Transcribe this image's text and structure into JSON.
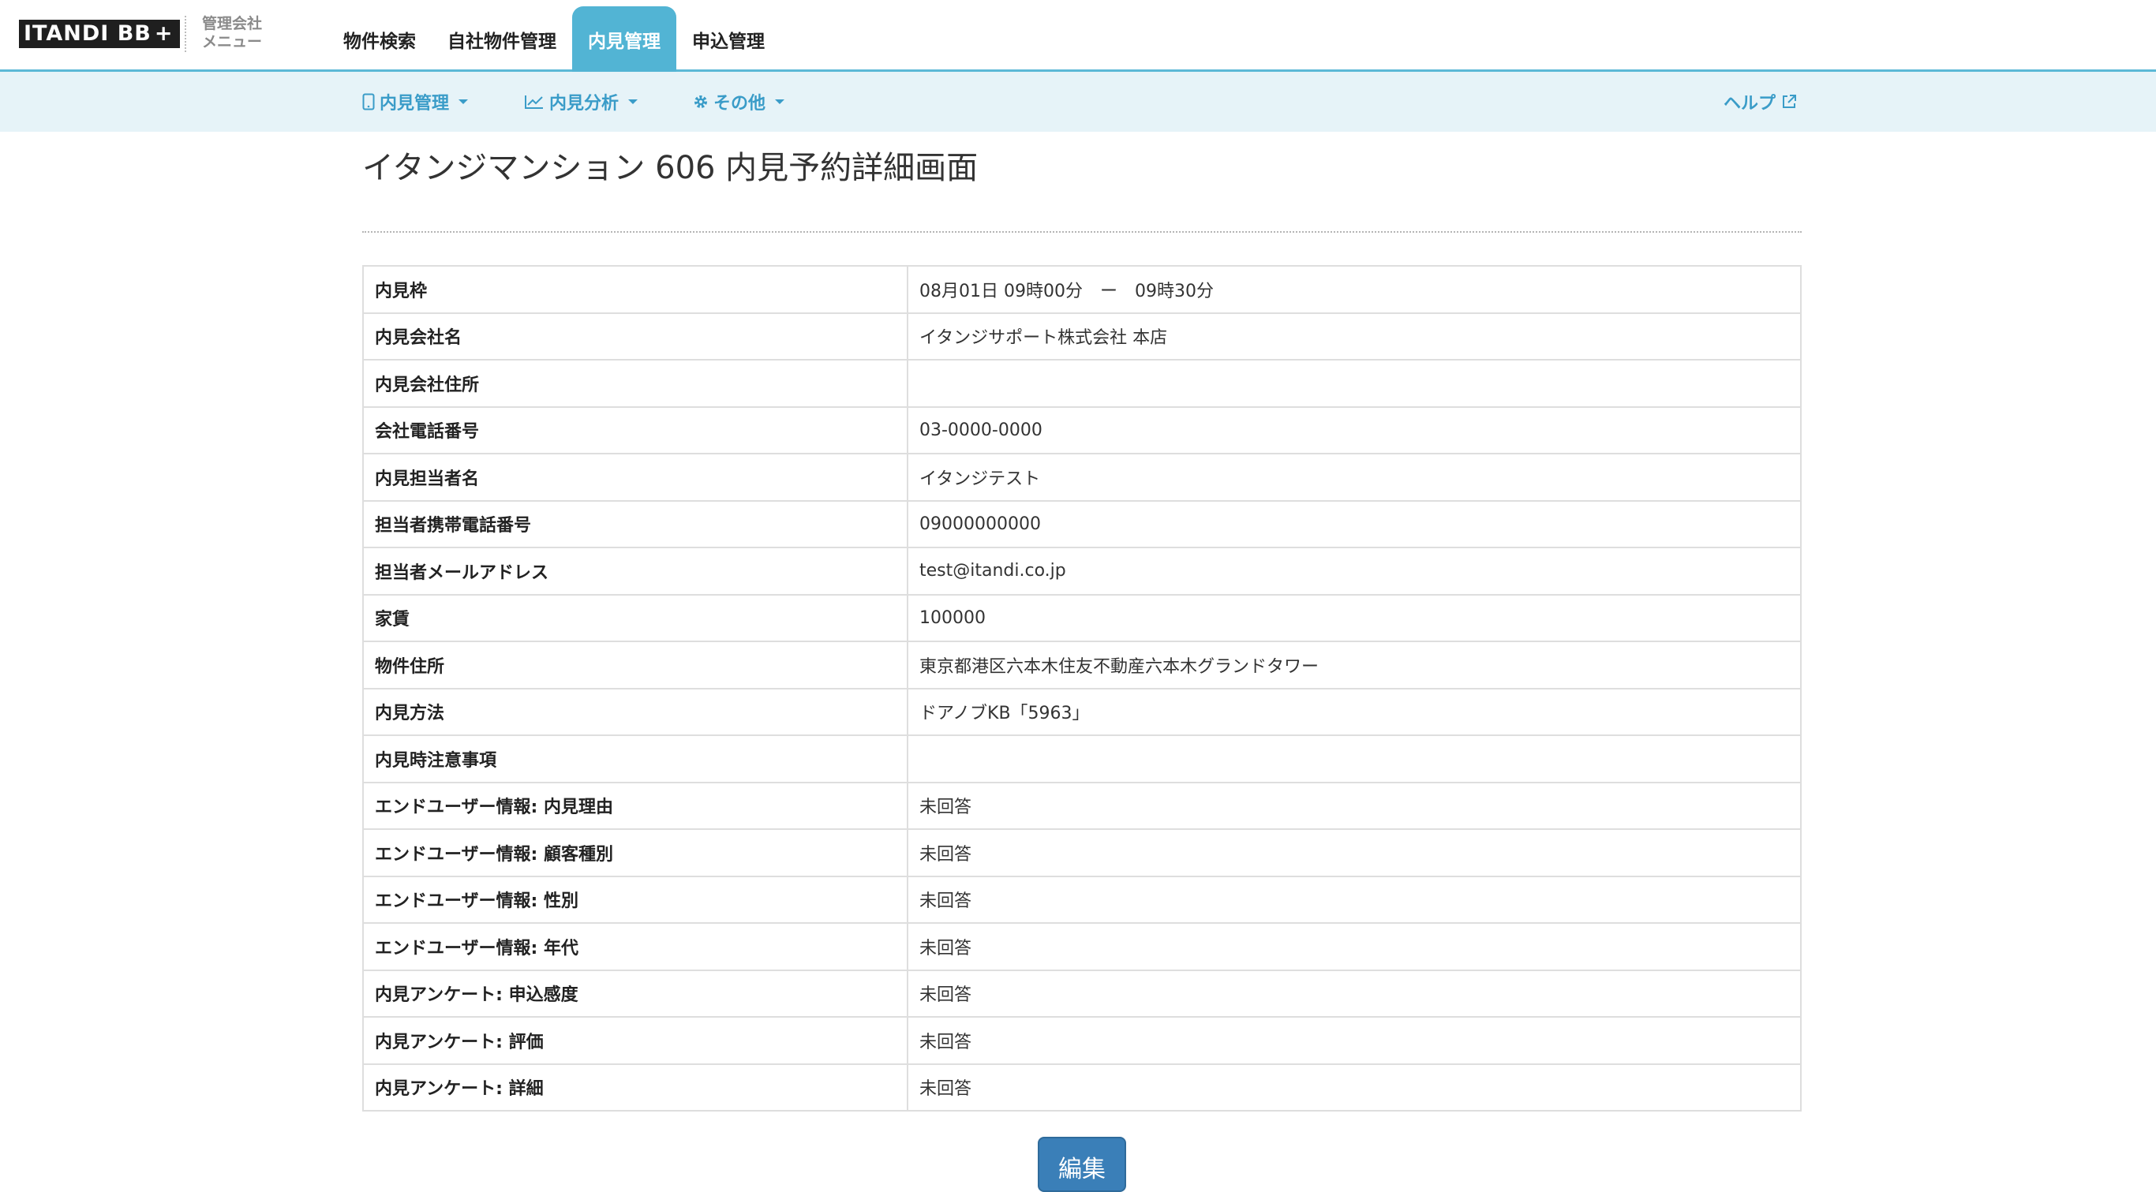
{
  "header": {
    "logo_text": "ITANDI BB",
    "logo_plus": "+",
    "company_menu_line1": "管理会社",
    "company_menu_line2": "メニュー",
    "tabs": [
      {
        "label": "物件検索",
        "active": false
      },
      {
        "label": "自社物件管理",
        "active": false
      },
      {
        "label": "内見管理",
        "active": true
      },
      {
        "label": "申込管理",
        "active": false
      }
    ]
  },
  "subnav": {
    "items": [
      {
        "label": "内見管理",
        "icon": "tablet-icon"
      },
      {
        "label": "内見分析",
        "icon": "line-chart-icon"
      },
      {
        "label": "その他",
        "icon": "gear-icon"
      }
    ],
    "help_label": "ヘルプ",
    "help_icon": "external-link-icon"
  },
  "page": {
    "title": "イタンジマンション 606 内見予約詳細画面",
    "rows": [
      {
        "label": "内見枠",
        "value": "08月01日 09時00分　ー　09時30分"
      },
      {
        "label": "内見会社名",
        "value": "イタンジサポート株式会社 本店"
      },
      {
        "label": "内見会社住所",
        "value": ""
      },
      {
        "label": "会社電話番号",
        "value": "03-0000-0000"
      },
      {
        "label": "内見担当者名",
        "value": "イタンジテスト"
      },
      {
        "label": "担当者携帯電話番号",
        "value": "09000000000"
      },
      {
        "label": "担当者メールアドレス",
        "value": "test@itandi.co.jp"
      },
      {
        "label": "家賃",
        "value": "100000"
      },
      {
        "label": "物件住所",
        "value": "東京都港区六本木住友不動産六本木グランドタワー"
      },
      {
        "label": "内見方法",
        "value": "ドアノブKB「5963」"
      },
      {
        "label": "内見時注意事項",
        "value": ""
      },
      {
        "label": "エンドユーザー情報: 内見理由",
        "value": "未回答"
      },
      {
        "label": "エンドユーザー情報: 顧客種別",
        "value": "未回答"
      },
      {
        "label": "エンドユーザー情報: 性別",
        "value": "未回答"
      },
      {
        "label": "エンドユーザー情報: 年代",
        "value": "未回答"
      },
      {
        "label": "内見アンケート: 申込感度",
        "value": "未回答"
      },
      {
        "label": "内見アンケート: 評価",
        "value": "未回答"
      },
      {
        "label": "内見アンケート: 詳細",
        "value": "未回答"
      }
    ],
    "edit_label": "編集"
  },
  "colors": {
    "accent": "#52b4d4",
    "subnav_bg": "#e6f3f8",
    "link": "#3a9cc8",
    "button": "#3a7fb8"
  }
}
